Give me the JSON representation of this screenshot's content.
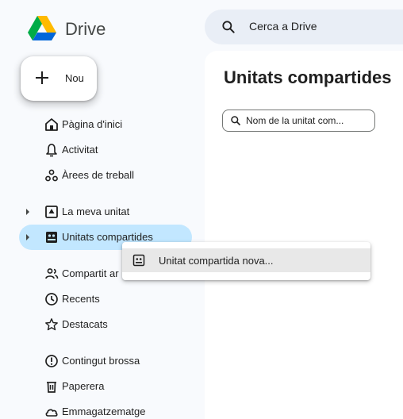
{
  "app": {
    "name": "Drive"
  },
  "search": {
    "placeholder": "Cerca a Drive"
  },
  "new_button": {
    "label": "Nou"
  },
  "sidebar": {
    "items": [
      {
        "label": "Pàgina d'inici",
        "icon": "home-icon"
      },
      {
        "label": "Activitat",
        "icon": "bell-icon"
      },
      {
        "label": "Àrees de treball",
        "icon": "workspaces-icon"
      },
      {
        "label": "La meva unitat",
        "icon": "my-drive-icon",
        "expandable": true
      },
      {
        "label": "Unitats compartides",
        "icon": "shared-drives-icon",
        "expandable": true,
        "active": true
      },
      {
        "label": "Compartit ar",
        "icon": "people-icon"
      },
      {
        "label": "Recents",
        "icon": "clock-icon"
      },
      {
        "label": "Destacats",
        "icon": "star-icon"
      },
      {
        "label": "Contingut brossa",
        "icon": "spam-icon"
      },
      {
        "label": "Paperera",
        "icon": "trash-icon"
      },
      {
        "label": "Emmagatzematge",
        "icon": "cloud-icon"
      }
    ]
  },
  "main": {
    "title": "Unitats compartides",
    "filter_placeholder": "Nom de la unitat com..."
  },
  "context_menu": {
    "items": [
      {
        "label": "Unitat compartida nova...",
        "icon": "shared-drive-add-icon"
      }
    ]
  },
  "colors": {
    "active_nav": "#c2e7ff",
    "background": "#f8fafd",
    "search_bg": "#e9eef6"
  }
}
